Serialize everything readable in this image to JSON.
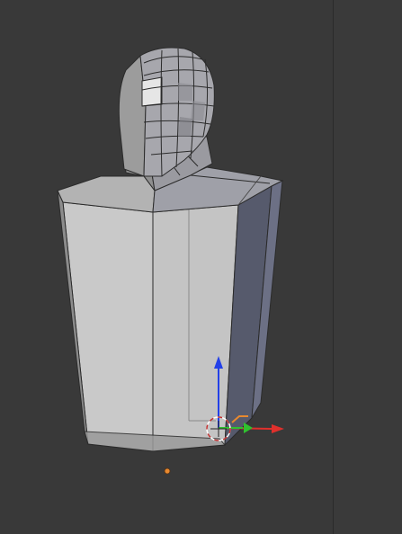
{
  "app": {
    "name": "3D Viewport",
    "object": "bust-mesh"
  },
  "colors": {
    "background": "#393939",
    "mesh_light": "#cfcfcf",
    "mesh_mid": "#a9a9ab",
    "mesh_dark": "#5c5f72",
    "wire": "#2b2b2b",
    "axis_x": "#e0302c",
    "axis_y": "#2fc22f",
    "axis_z": "#2340e8",
    "origin": "#e8892f",
    "cursor_ring": "#ffffff"
  },
  "icons": {
    "cursor": "3d-cursor-icon",
    "gizmo": "transform-gizmo-icon",
    "origin": "object-origin-icon"
  }
}
